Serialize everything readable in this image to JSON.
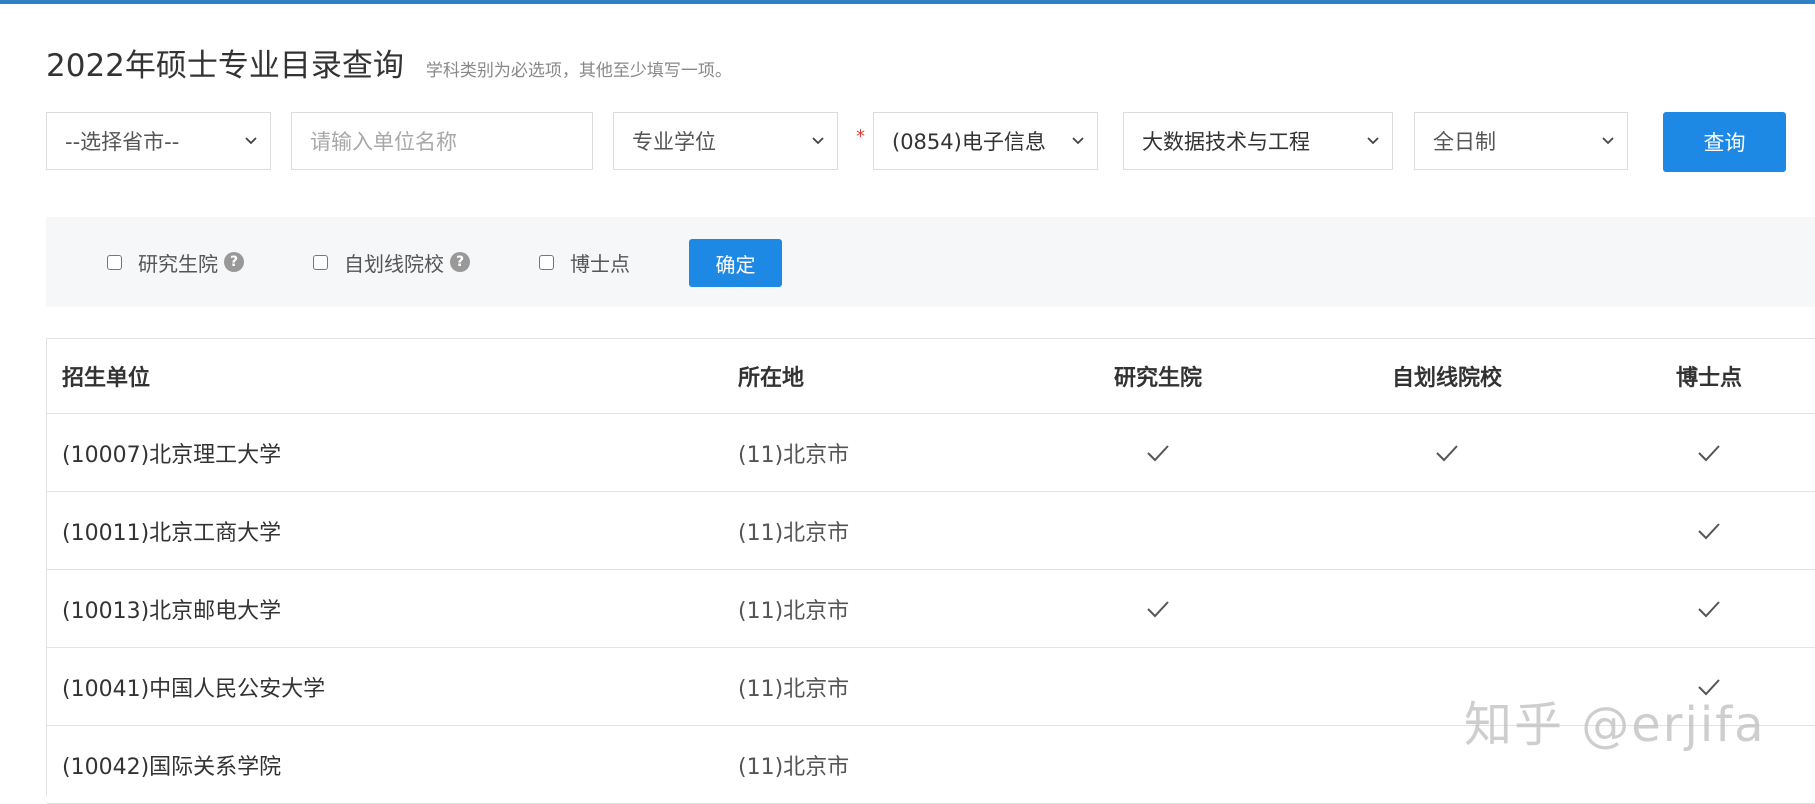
{
  "page": {
    "title": "2022年硕士专业目录查询",
    "subtitle": "学科类别为必选项，其他至少填写一项。"
  },
  "search": {
    "province": "--选择省市--",
    "unit_placeholder": "请输入单位名称",
    "degree_type": "专业学位",
    "required_mark": "*",
    "discipline": "(0854)电子信息",
    "specialty": "大数据技术与工程",
    "study_mode": "全日制",
    "query_label": "查询"
  },
  "filters": {
    "grad_school_label": "研究生院",
    "self_line_label": "自划线院校",
    "doctoral_label": "博士点",
    "help_glyph": "?",
    "confirm_label": "确定"
  },
  "table": {
    "headers": {
      "unit": "招生单位",
      "location": "所在地",
      "grad_school": "研究生院",
      "self_line": "自划线院校",
      "doctoral": "博士点"
    },
    "rows": [
      {
        "unit": "(10007)北京理工大学",
        "location": "(11)北京市",
        "grad_school": true,
        "self_line": true,
        "doctoral": true
      },
      {
        "unit": "(10011)北京工商大学",
        "location": "(11)北京市",
        "grad_school": false,
        "self_line": false,
        "doctoral": true
      },
      {
        "unit": "(10013)北京邮电大学",
        "location": "(11)北京市",
        "grad_school": true,
        "self_line": false,
        "doctoral": true
      },
      {
        "unit": "(10041)中国人民公安大学",
        "location": "(11)北京市",
        "grad_school": false,
        "self_line": false,
        "doctoral": true
      },
      {
        "unit": "(10042)国际关系学院",
        "location": "(11)北京市",
        "grad_school": false,
        "self_line": false,
        "doctoral": false
      }
    ]
  },
  "watermark": "知乎 @erjifa",
  "colors": {
    "accent": "#1e88e5",
    "top_bar": "#2f7fc4",
    "required": "#e03c31"
  }
}
